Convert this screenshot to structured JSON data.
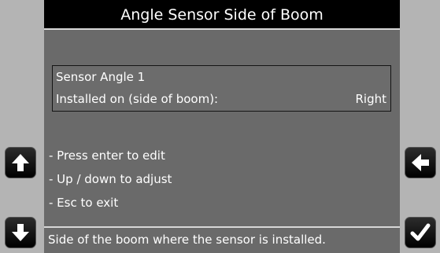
{
  "header": {
    "title": "Angle Sensor Side of Boom"
  },
  "setting": {
    "name": "Sensor Angle 1",
    "label": "Installed on (side of boom):",
    "value": "Right"
  },
  "instructions": [
    "- Press enter to edit",
    "- Up / down to adjust",
    "- Esc to exit"
  ],
  "status": {
    "text": "Side of the boom where the sensor is installed."
  },
  "buttons": {
    "up_icon": "arrow-up-icon",
    "down_icon": "arrow-down-icon",
    "back_icon": "arrow-left-icon",
    "confirm_icon": "checkmark-icon"
  },
  "colors": {
    "screen_bg": "#6a6a6a",
    "title_bg": "#000000",
    "bezel": "#b4b4b4",
    "button_bg": "#000000",
    "text": "#ffffff"
  }
}
